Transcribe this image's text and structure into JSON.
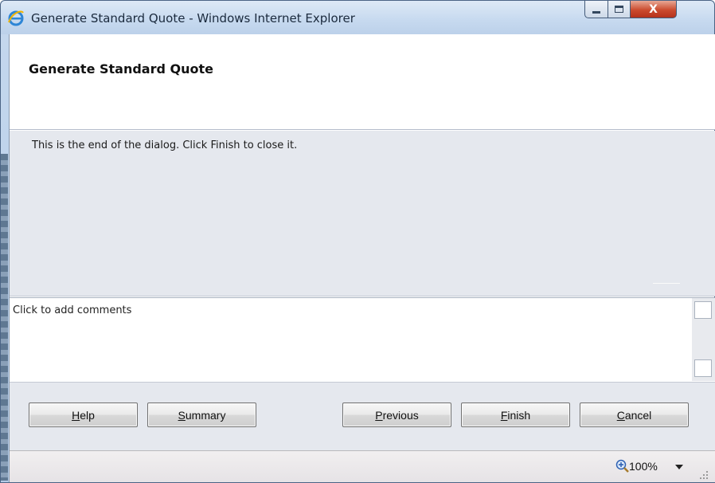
{
  "window": {
    "title": "Generate Standard Quote - Windows Internet Explorer",
    "icon": "ie-icon",
    "controls": {
      "minimize": "minimize-icon",
      "maximize": "maximize-icon",
      "close": "X"
    }
  },
  "dialog": {
    "title": "Generate Standard Quote",
    "message": "This is the end of the dialog. Click Finish to close it."
  },
  "comments": {
    "placeholder": "Click to add comments",
    "value": ""
  },
  "buttons": {
    "help": {
      "mnemonic": "H",
      "rest": "elp"
    },
    "summary": {
      "mnemonic": "S",
      "rest": "ummary"
    },
    "previous": {
      "mnemonic": "P",
      "rest": "revious"
    },
    "finish": {
      "mnemonic": "F",
      "rest": "inish"
    },
    "cancel": {
      "mnemonic": "C",
      "rest": "ancel"
    }
  },
  "statusbar": {
    "zoom": "100%",
    "zoom_icon": "zoom-icon"
  },
  "colors": {
    "titlebar": "#c6d9ef",
    "close_button": "#cb4b2f",
    "dialog_body": "#e5e8ee"
  }
}
